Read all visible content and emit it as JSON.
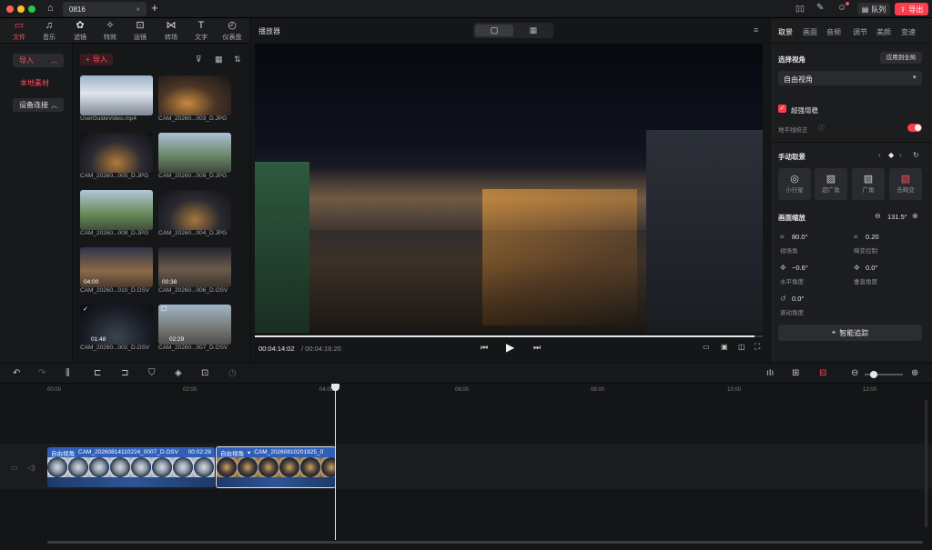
{
  "app": {
    "tab_label": "0816",
    "queue_label": "队列",
    "export_label": "导出"
  },
  "toolbar": {
    "items": [
      "文件",
      "音乐",
      "滤镜",
      "特效",
      "运镜",
      "转场",
      "文字",
      "仪表盘"
    ]
  },
  "left_nav": {
    "import_label": "导入",
    "local_label": "本地素材",
    "device_label": "设备连接"
  },
  "media": {
    "import_button": "导入",
    "items": [
      {
        "name": "UserGuideVideo.mp4",
        "duration": ""
      },
      {
        "name": "CAM_20260...003_D.JPG",
        "duration": ""
      },
      {
        "name": "CAM_20260...005_D.JPG",
        "duration": ""
      },
      {
        "name": "CAM_20260...009_D.JPG",
        "duration": ""
      },
      {
        "name": "CAM_20260...008_D.JPG",
        "duration": ""
      },
      {
        "name": "CAM_20260...004_D.JPG",
        "duration": ""
      },
      {
        "name": "CAM_20260...010_D.OSV",
        "duration": "04:00"
      },
      {
        "name": "CAM_20260...006_D.OSV",
        "duration": "00:38"
      },
      {
        "name": "CAM_20260...002_D.OSV",
        "duration": "01:48"
      },
      {
        "name": "CAM_20260...007_D.OSV",
        "duration": "02:29"
      }
    ]
  },
  "player": {
    "title": "播放器",
    "current_time": "00:04:14:02",
    "total_time": "/ 00:04:16:20",
    "progress": 0.983
  },
  "inspector": {
    "tabs": [
      "取景",
      "画面",
      "音频",
      "调节",
      "美颜",
      "变速"
    ],
    "view_title": "选择视角",
    "apply_all": "应用到全局",
    "view_mode": "自由视角",
    "enhance": "超强增稳",
    "horizon": "地平线校正",
    "manual_title": "手动取景",
    "presets": [
      "小行星",
      "超广角",
      "广角",
      "去畸变"
    ],
    "zoom_title": "画面缩放",
    "zoom_value": "131.5°",
    "params": [
      {
        "value": "80.0°",
        "label": "视场角"
      },
      {
        "value": "0.20",
        "label": "畸变控制"
      },
      {
        "value": "−0.6°",
        "label": "水平角度"
      },
      {
        "value": "0.0°",
        "label": "垂直角度"
      },
      {
        "value": "0.0°",
        "label": "滚动角度"
      }
    ],
    "track_button": "智能追踪"
  },
  "timeline": {
    "ticks": [
      "00:00",
      "02:00",
      "04:00",
      "06:00",
      "08:00",
      "10:00",
      "12:00"
    ],
    "clip1": {
      "mode": "自由视角",
      "name": "CAM_20260814110224_0007_D.OSV",
      "duration": "00:02:28"
    },
    "clip2": {
      "mode": "自由视角",
      "name": "CAM_20260810201925_0"
    }
  },
  "colors": {
    "accent": "#ff4d5e",
    "clip": "#2f5fb8"
  }
}
